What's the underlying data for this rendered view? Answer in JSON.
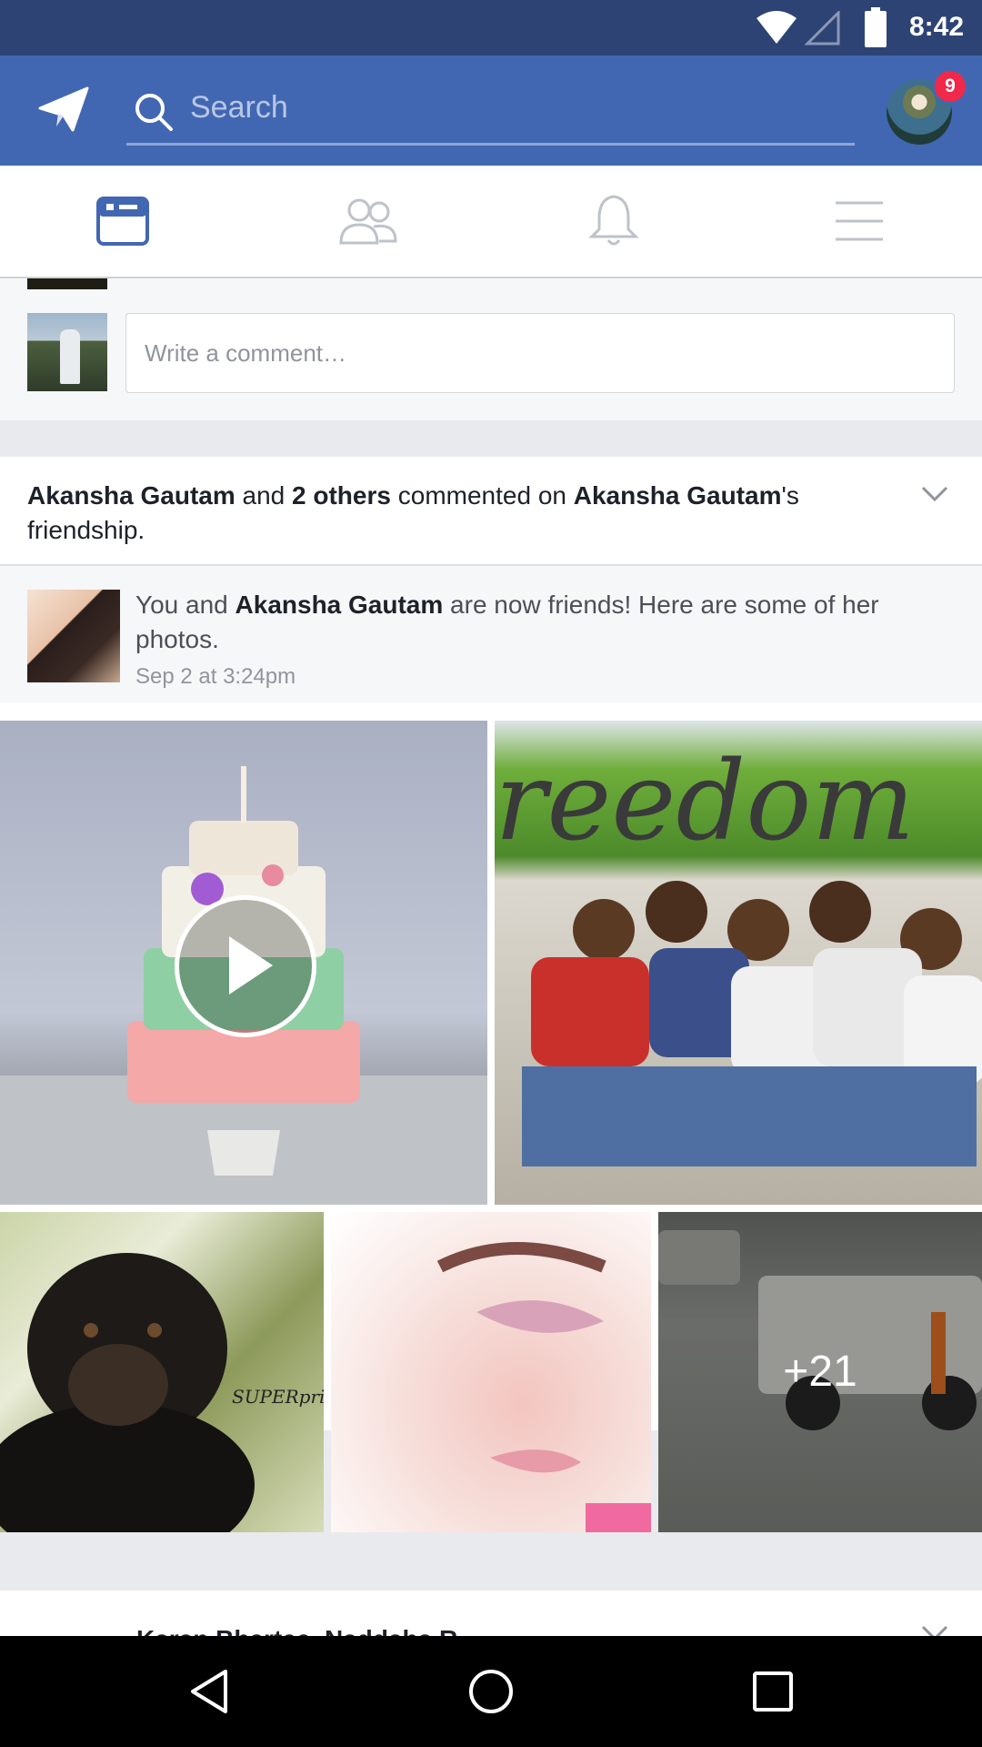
{
  "status_bar": {
    "time": "8:42"
  },
  "header": {
    "search_placeholder": "Search",
    "notification_count": "9"
  },
  "tabs": [
    {
      "name": "news-feed",
      "active": true
    },
    {
      "name": "friends",
      "active": false
    },
    {
      "name": "notifications",
      "active": false
    },
    {
      "name": "menu",
      "active": false
    }
  ],
  "comment_box": {
    "placeholder": "Write a comment…"
  },
  "story": {
    "actor": "Akansha Gautam",
    "conj": " and ",
    "others": "2 others",
    "action": " commented on ",
    "target": "Akansha Gautam",
    "suffix": "'s friendship.",
    "post": {
      "prefix": "You and ",
      "friend": "Akansha Gautam",
      "suffix": " are now friends! Here are some of her photos.",
      "timestamp": "Sep 2 at 3:24pm"
    },
    "photos": {
      "more_count": "+21",
      "dog_watermark": "SUPERpride"
    }
  },
  "next_story": {
    "title": "Karan Bhartee, Naddaha R"
  },
  "colors": {
    "brand": "#4267b2",
    "status_bar": "#2d4373",
    "badge": "#f02849",
    "tab_active": "#4267b2",
    "tab_inactive": "#bec2c9"
  }
}
